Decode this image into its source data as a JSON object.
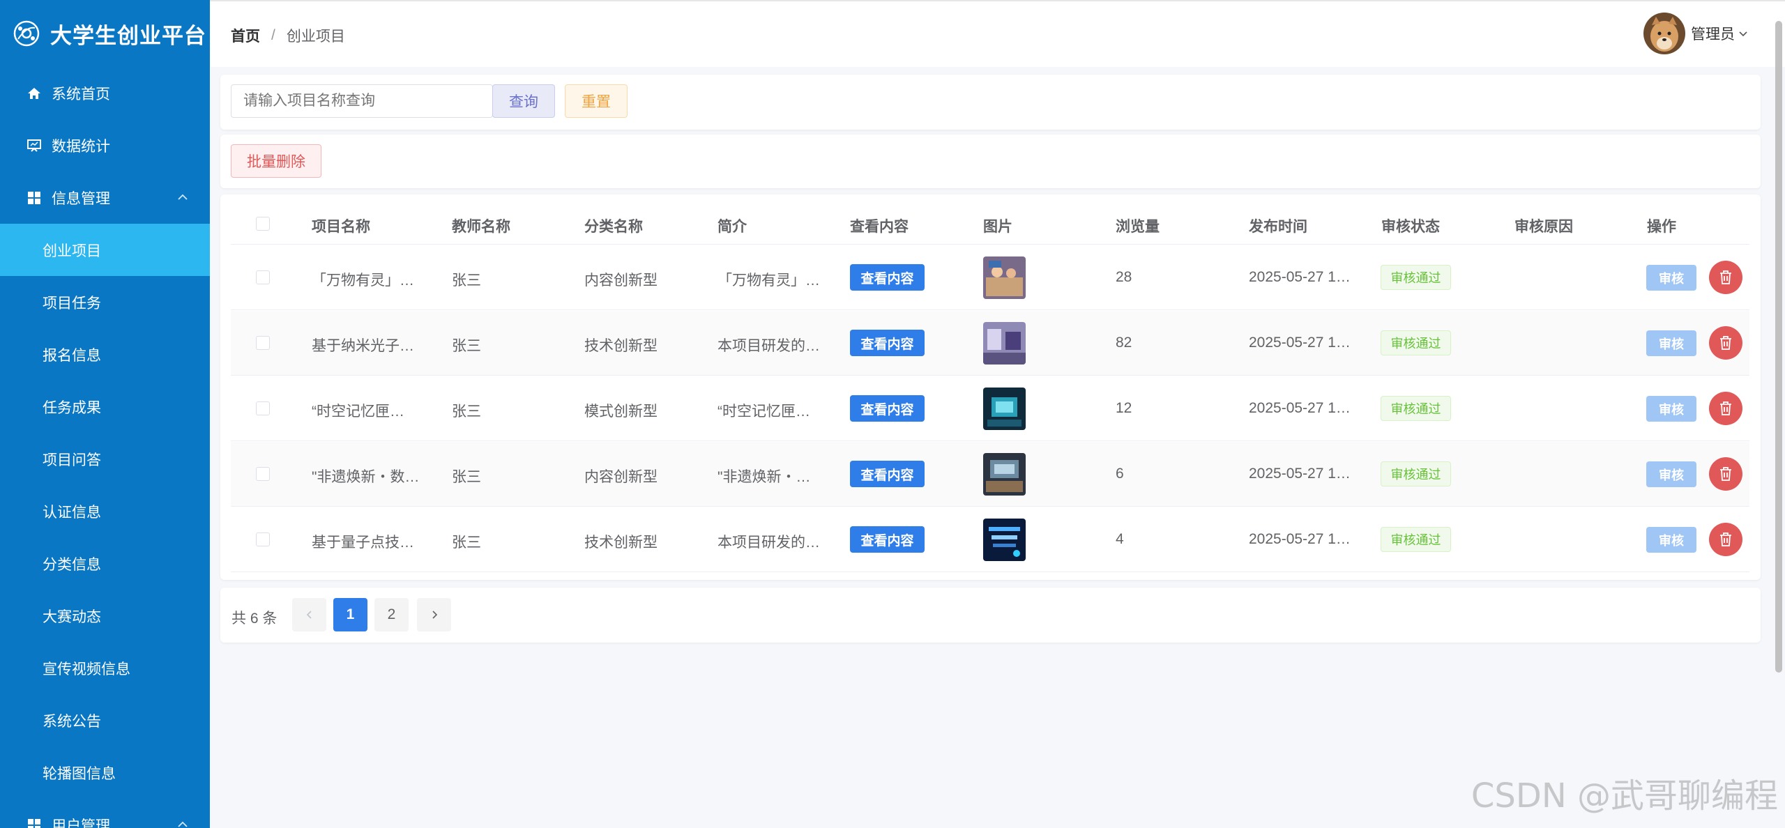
{
  "sidebar": {
    "title": "大学生创业平台",
    "items": [
      {
        "label": "系统首页",
        "icon": "home-icon"
      },
      {
        "label": "数据统计",
        "icon": "monitor-icon"
      },
      {
        "label": "信息管理",
        "icon": "grid-icon",
        "expanded": true
      }
    ],
    "sub_items": [
      "创业项目",
      "项目任务",
      "报名信息",
      "任务成果",
      "项目问答",
      "认证信息",
      "分类信息",
      "大赛动态",
      "宣传视频信息",
      "系统公告",
      "轮播图信息"
    ],
    "active_sub": "创业项目",
    "group2": {
      "label": "用户管理",
      "icon": "grid-icon"
    }
  },
  "header": {
    "breadcrumb_home": "首页",
    "breadcrumb_sep": "/",
    "breadcrumb_current": "创业项目",
    "user_name": "管理员"
  },
  "search": {
    "placeholder": "请输入项目名称查询",
    "query_label": "查询",
    "reset_label": "重置"
  },
  "actions": {
    "batch_delete_label": "批量删除"
  },
  "table": {
    "columns": [
      "项目名称",
      "教师名称",
      "分类名称",
      "简介",
      "查看内容",
      "图片",
      "浏览量",
      "发布时间",
      "审核状态",
      "审核原因",
      "操作"
    ],
    "rows": [
      {
        "name": "「万物有灵」…",
        "teacher": "张三",
        "category": "内容创新型",
        "intro": "「万物有灵」…",
        "view_label": "查看内容",
        "views": "28",
        "time": "2025-05-27 1…",
        "status": "审核通过",
        "reason": "",
        "audit_label": "审核"
      },
      {
        "name": "基于纳米光子…",
        "teacher": "张三",
        "category": "技术创新型",
        "intro": "本项目研发的…",
        "view_label": "查看内容",
        "views": "82",
        "time": "2025-05-27 1…",
        "status": "审核通过",
        "reason": "",
        "audit_label": "审核"
      },
      {
        "name": "“时空记忆匣…",
        "teacher": "张三",
        "category": "模式创新型",
        "intro": "“时空记忆匣…",
        "view_label": "查看内容",
        "views": "12",
        "time": "2025-05-27 1…",
        "status": "审核通过",
        "reason": "",
        "audit_label": "审核"
      },
      {
        "name": "\"非遗焕新・数…",
        "teacher": "张三",
        "category": "内容创新型",
        "intro": "\"非遗焕新・…",
        "view_label": "查看内容",
        "views": "6",
        "time": "2025-05-27 1…",
        "status": "审核通过",
        "reason": "",
        "audit_label": "审核"
      },
      {
        "name": "基于量子点技…",
        "teacher": "张三",
        "category": "技术创新型",
        "intro": "本项目研发的…",
        "view_label": "查看内容",
        "views": "4",
        "time": "2025-05-27 1…",
        "status": "审核通过",
        "reason": "",
        "audit_label": "审核"
      }
    ]
  },
  "pagination": {
    "total": "共 6 条",
    "pages": [
      "1",
      "2"
    ],
    "current": "1"
  },
  "watermark": "CSDN @武哥聊编程",
  "colors": {
    "sidebar": "#0a77c5",
    "active": "#2db7f0",
    "primary": "#2f7de8",
    "success": "#67c23a",
    "danger": "#e05858"
  }
}
